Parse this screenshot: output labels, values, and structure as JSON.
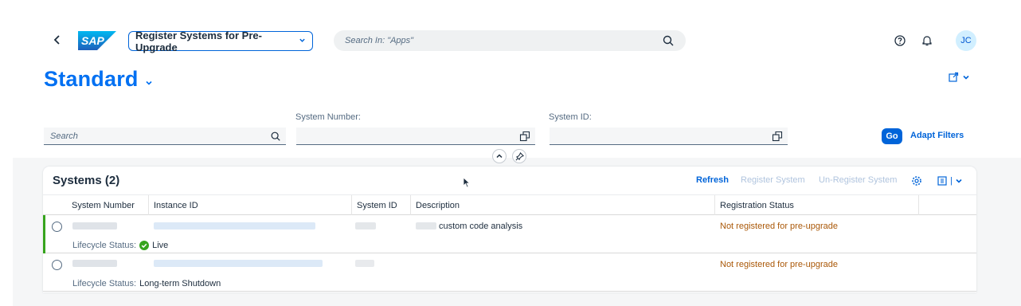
{
  "shell": {
    "back_glyph": "‹",
    "logo_text": "SAP",
    "app_title": "Register Systems for Pre-Upgrade",
    "search_placeholder": "Search In: \"Apps\"",
    "avatar_initials": "JC",
    "icons": [
      "back-icon",
      "search-icon",
      "help-icon",
      "bell-icon"
    ]
  },
  "variant": {
    "title": "Standard"
  },
  "filters": {
    "search_placeholder": "Search",
    "system_number_label": "System Number:",
    "system_id_label": "System ID:",
    "go_label": "Go",
    "adapt_label": "Adapt Filters"
  },
  "table": {
    "title": "Systems (2)",
    "toolbar": {
      "refresh": "Refresh",
      "register": "Register System",
      "unregister": "Un-Register System"
    },
    "columns": [
      "System Number",
      "Instance ID",
      "System ID",
      "Description",
      "Registration Status"
    ],
    "rows": [
      {
        "description": "custom code analysis",
        "registration_status": "Not registered for pre-upgrade",
        "lifecycle_label": "Lifecycle Status:",
        "lifecycle_value": "Live",
        "selected_accent": true
      },
      {
        "description": "",
        "registration_status": "Not registered for pre-upgrade",
        "lifecycle_label": "Lifecycle Status:",
        "lifecycle_value": "Long-term Shutdown",
        "selected_accent": false
      }
    ]
  },
  "colors": {
    "brand_blue": "#0070f2",
    "button_blue": "#0064d9",
    "warning_text": "#aa5808",
    "live_green": "#36a41d"
  }
}
